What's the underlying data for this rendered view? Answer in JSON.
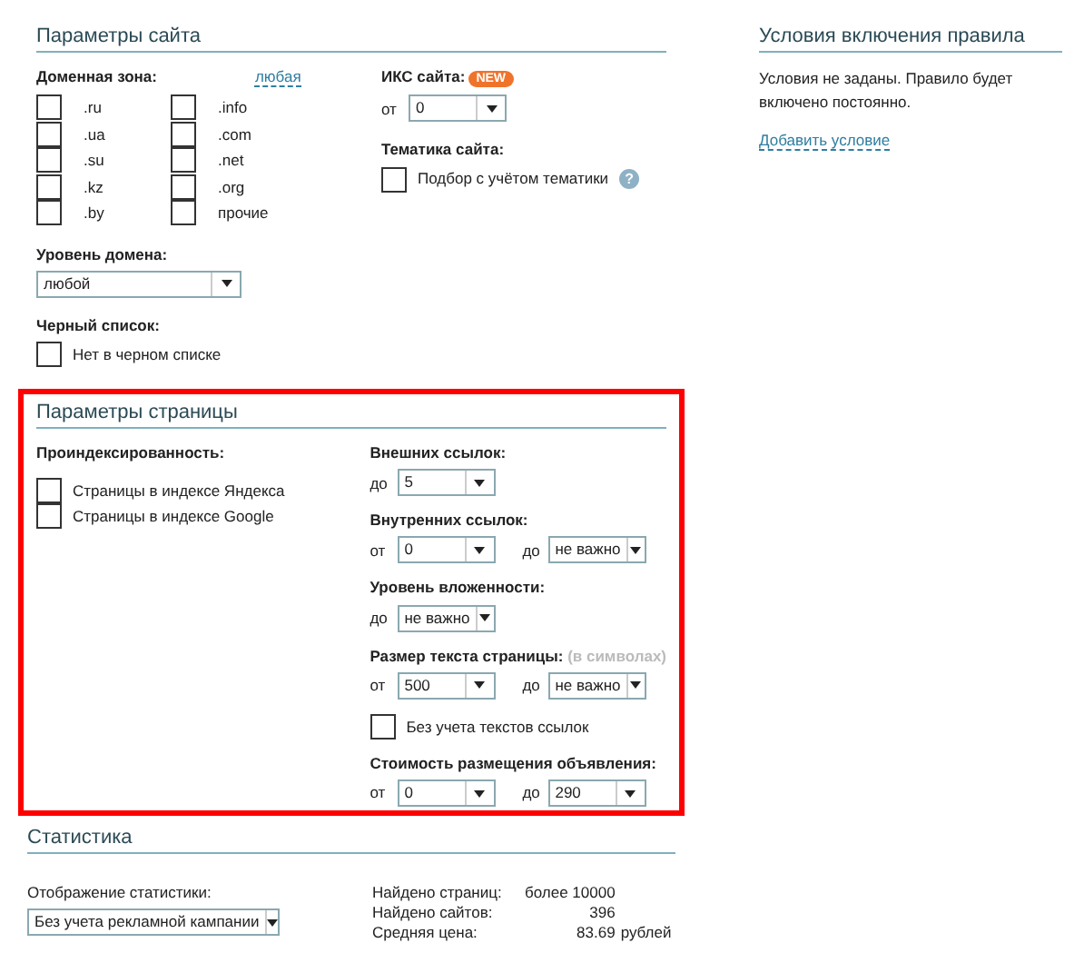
{
  "site_params": {
    "title": "Параметры сайта",
    "domain_zone": {
      "label": "Доменная зона:",
      "link": "любая",
      "options": [
        {
          "label": ".ru",
          "checked": false
        },
        {
          "label": ".ua",
          "checked": false
        },
        {
          "label": ".su",
          "checked": false
        },
        {
          "label": ".kz",
          "checked": false
        },
        {
          "label": ".by",
          "checked": false
        },
        {
          "label": ".info",
          "checked": false
        },
        {
          "label": ".com",
          "checked": false
        },
        {
          "label": ".net",
          "checked": false
        },
        {
          "label": ".org",
          "checked": false
        },
        {
          "label": "прочие",
          "checked": false
        }
      ]
    },
    "domain_level": {
      "label": "Уровень домена:",
      "value": "любой"
    },
    "blacklist": {
      "label": "Черный список:",
      "option": {
        "label": "Нет в черном списке",
        "checked": false
      }
    },
    "iks": {
      "label": "ИКС сайта:",
      "badge": "NEW",
      "prefix": "от",
      "value": "0"
    },
    "topic": {
      "label": "Тематика сайта:",
      "option": {
        "label": "Подбор с учётом тематики",
        "checked": false
      },
      "help": "?"
    }
  },
  "page_params": {
    "title": "Параметры страницы",
    "highlighted": true,
    "indexing": {
      "label": "Проиндексированность:",
      "options": [
        {
          "label": "Страницы в индексе Яндекса",
          "checked": false
        },
        {
          "label": "Страницы в индексе Google",
          "checked": false
        }
      ]
    },
    "filters": [
      {
        "kind": "range",
        "label": "Внешних ссылок:",
        "selects": [
          {
            "prefix": "до",
            "value": "5"
          }
        ]
      },
      {
        "kind": "range",
        "label": "Внутренних ссылок:",
        "selects": [
          {
            "prefix": "от",
            "value": "0"
          },
          {
            "prefix": "до",
            "value": "не важно"
          }
        ]
      },
      {
        "kind": "range",
        "label": "Уровень вложенности:",
        "selects": [
          {
            "prefix": "до",
            "value": "не важно"
          }
        ]
      },
      {
        "kind": "range",
        "label": "Размер текста страницы:",
        "note": "(в символах)",
        "selects": [
          {
            "prefix": "от",
            "value": "500"
          },
          {
            "prefix": "до",
            "value": "не важно"
          }
        ]
      },
      {
        "kind": "checkbox",
        "label": "Без учета текстов ссылок",
        "checked": false
      },
      {
        "kind": "range",
        "label": "Стоимость размещения объявления:",
        "selects": [
          {
            "prefix": "от",
            "value": "0"
          },
          {
            "prefix": "до",
            "value": "290"
          }
        ]
      }
    ]
  },
  "statistics": {
    "title": "Статистика",
    "display": {
      "label": "Отображение статистики:",
      "value": "Без учета рекламной кампании"
    },
    "rows": [
      {
        "label": "Найдено страниц:",
        "value": "более 10000"
      },
      {
        "label": "Найдено сайтов:",
        "value": "396"
      },
      {
        "label": "Средняя цена:",
        "value": "83.69",
        "unit": "рублей"
      }
    ]
  },
  "conditions": {
    "title": "Условия включения правила",
    "text": "Условия не заданы. Правило будет включено постоянно.",
    "link": "Добавить условие"
  }
}
